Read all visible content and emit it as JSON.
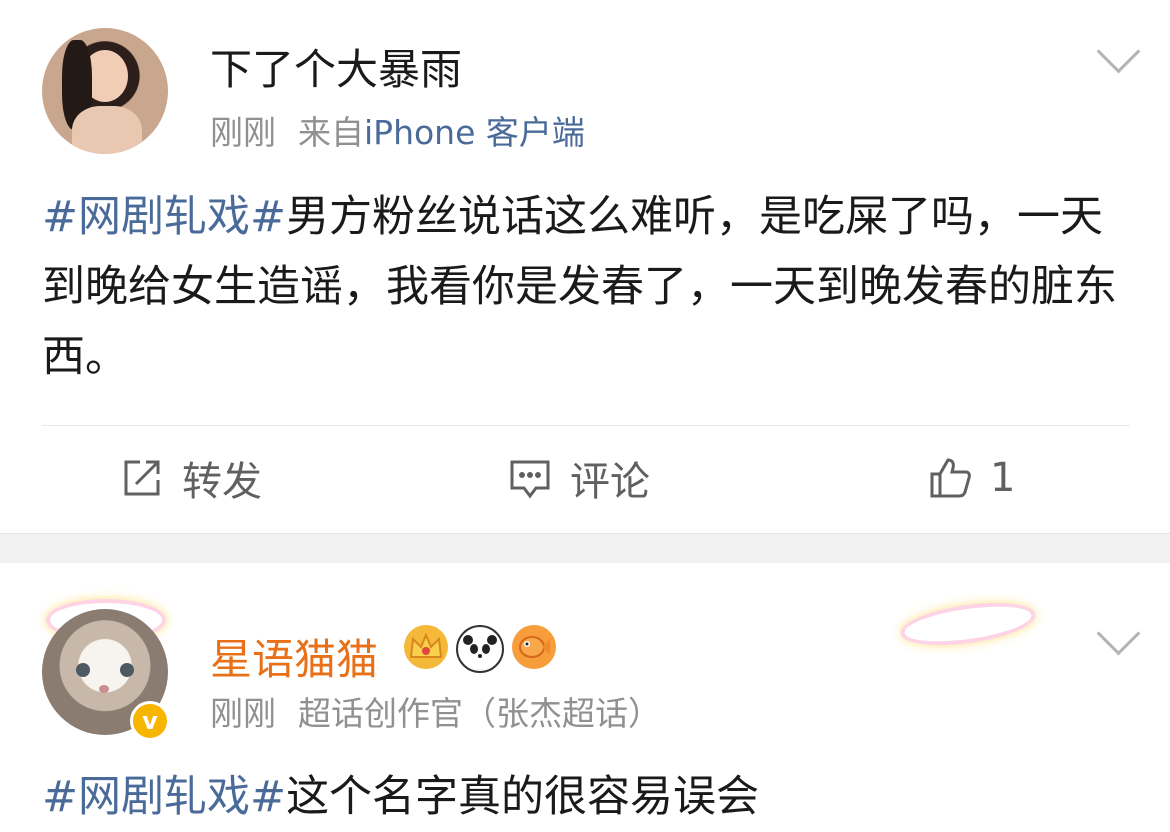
{
  "posts": [
    {
      "author": "下了个大暴雨",
      "time": "刚刚",
      "source_prefix": "来自",
      "source": "iPhone 客户端",
      "hashtag": "#网剧轧戏#",
      "text": "男方粉丝说话这么难听，是吃屎了吗，一天到晚给女生造谣，我看你是发春了，一天到晚发春的脏东西。",
      "actions": {
        "repost_label": "转发",
        "comment_label": "评论",
        "like_count": "1"
      }
    },
    {
      "author": "星语猫猫",
      "badge_icons": [
        "crown-icon",
        "panda-icon",
        "fish-icon"
      ],
      "time": "刚刚",
      "role": "超话创作官（张杰超话）",
      "hashtag": "#网剧轧戏#",
      "text": "这个名字真的很容易误会"
    }
  ],
  "colors": {
    "link_blue": "#4a6b99",
    "vip_name_orange": "#e87018",
    "meta_gray": "#909090",
    "verified_gold": "#f7b500"
  }
}
